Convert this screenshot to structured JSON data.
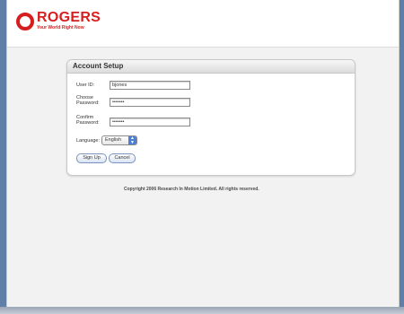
{
  "brand": {
    "name": "ROGERS",
    "tagline": "Your World Right Now",
    "color": "#d61e1e"
  },
  "panel": {
    "title": "Account Setup"
  },
  "form": {
    "user_id_label": "User ID:",
    "user_id_value": "bjones",
    "choose_password_label_1": "Choose",
    "choose_password_label_2": "Password:",
    "choose_password_value": "•••••••",
    "confirm_password_label_1": "Confirm",
    "confirm_password_label_2": "Password:",
    "confirm_password_value": "•••••••",
    "language_label": "Language:",
    "language_value": "English"
  },
  "buttons": {
    "sign_up": "Sign Up",
    "cancel": "Cancel"
  },
  "footer": {
    "copyright": "Copyright 2006 Research In Motion Limited. All rights reserved."
  },
  "icons": {
    "logo": "rogers-logo-icon",
    "select_arrows": "updown-arrows-icon"
  }
}
